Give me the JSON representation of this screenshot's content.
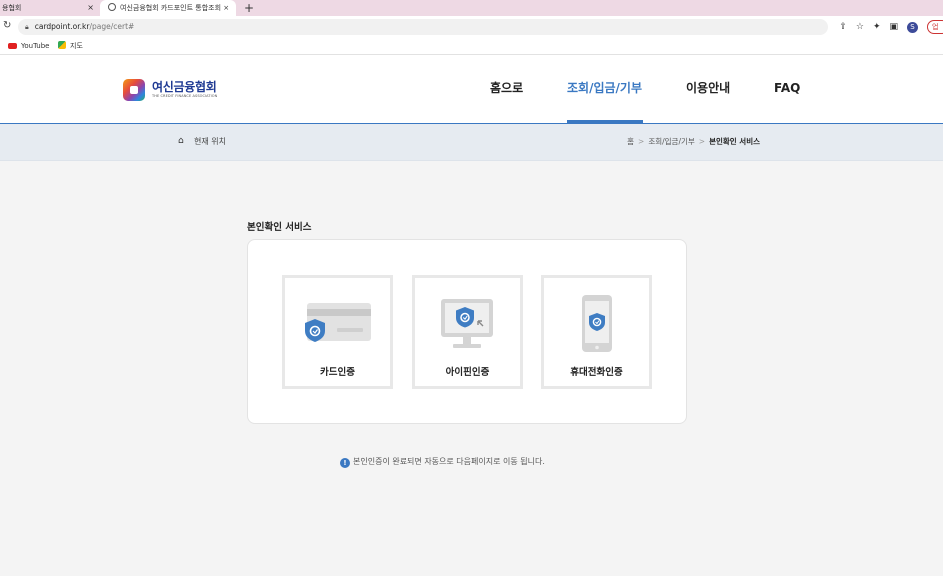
{
  "browser": {
    "tabs": [
      {
        "title": "용협회",
        "active": false
      },
      {
        "title": "여신금융협회 카드포인트 통합조회 ×",
        "active": true
      }
    ],
    "new_tab_label": "+",
    "url_host": "cardpoint.or.kr",
    "url_path": "/page/cert#",
    "bookmarks": [
      {
        "label": "YouTube",
        "icon": "youtube-icon"
      },
      {
        "label": "지도",
        "icon": "maps-icon"
      }
    ],
    "profile_initial": "S",
    "update_label": "업"
  },
  "site": {
    "logo": {
      "ko": "여신금융협회",
      "en": "THE CREDIT FINANCE ASSOCIATION"
    },
    "nav": [
      {
        "label": "홈으로",
        "active": false
      },
      {
        "label": "조회/입금/기부",
        "active": true
      },
      {
        "label": "이용안내",
        "active": false
      },
      {
        "label": "FAQ",
        "active": false
      }
    ],
    "accent_color": "#3a78c2"
  },
  "location": {
    "label": "현재 위치",
    "crumbs": [
      "홈",
      "조회/입금/기부",
      "본인확인 서비스"
    ]
  },
  "main": {
    "section_title": "본인확인 서비스",
    "options": [
      {
        "label": "카드인증",
        "icon": "credit-card-shield-icon"
      },
      {
        "label": "아이핀인증",
        "icon": "monitor-shield-icon"
      },
      {
        "label": "휴대전화인증",
        "icon": "mobile-phone-shield-icon"
      }
    ],
    "notice_icon": "!",
    "notice": "본인인증이 완료되면 자동으로 다음페이지로 이동 됩니다."
  }
}
